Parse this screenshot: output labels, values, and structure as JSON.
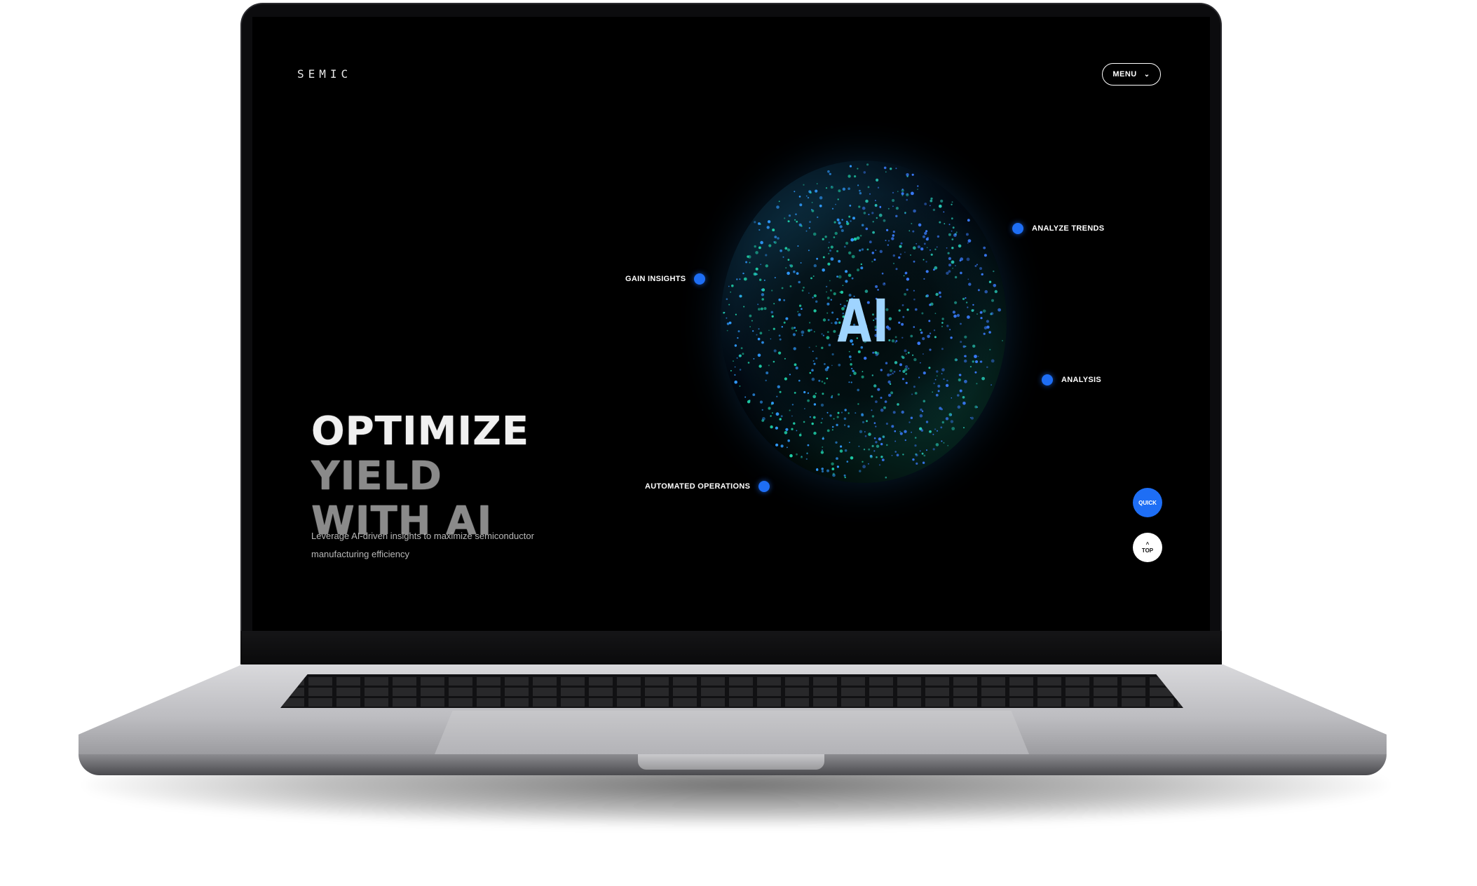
{
  "header": {
    "logo_text": "SEMIC",
    "menu_label": "MENU"
  },
  "visual": {
    "center_label": "AI",
    "nodes": {
      "analyze_trends": "ANALYZE TRENDS",
      "gain_insights": "GAIN INSIGHTS",
      "analysis": "ANALYSIS",
      "automated_operations": "AUTOMATED OPERATIONS"
    },
    "accent_color": "#1e6ef5"
  },
  "hero": {
    "headline_line1_a": "OPTIMIZE",
    "headline_line1_b": "YIELD",
    "headline_line2": "WITH AI",
    "subtext": "Leverage AI-driven insights to maximize semiconductor manufacturing efficiency"
  },
  "floating": {
    "quick_label": "QUICK",
    "top_arrow": "^",
    "top_label": "TOP"
  }
}
